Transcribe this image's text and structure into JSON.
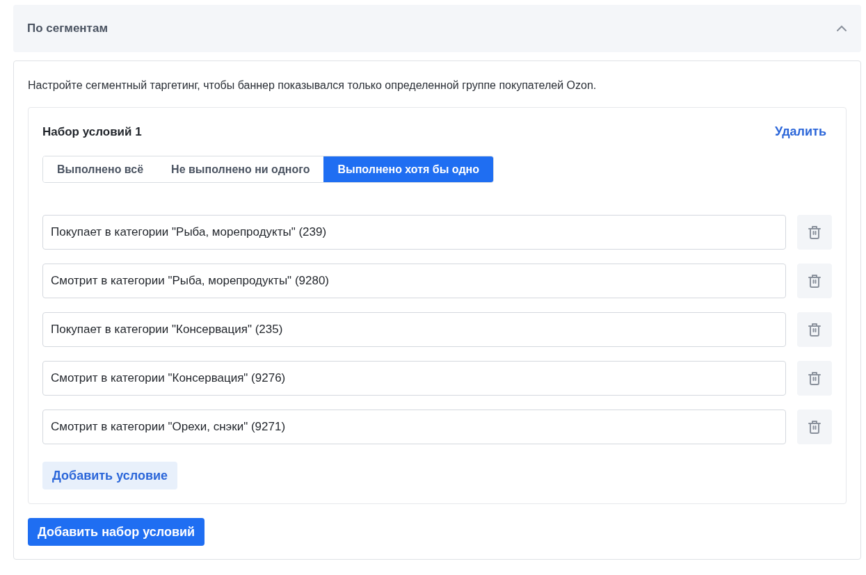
{
  "section": {
    "title": "По сегментам",
    "expanded": true
  },
  "description": "Настройте сегментный таргетинг, чтобы баннер показывался только определенной группе покупателей Ozon.",
  "condition_sets": [
    {
      "title": "Набор условий 1",
      "delete_label": "Удалить",
      "modes": [
        {
          "label": "Выполнено всё",
          "selected": false
        },
        {
          "label": "Не выполнено ни одного",
          "selected": false
        },
        {
          "label": "Выполнено хотя бы одно",
          "selected": true
        }
      ],
      "conditions": [
        {
          "value": "Покупает в категории \"Рыба, морепродукты\" (239)"
        },
        {
          "value": "Смотрит в категории \"Рыба, морепродукты\" (9280)"
        },
        {
          "value": "Покупает в категории \"Консервация\" (235)"
        },
        {
          "value": "Смотрит в категории \"Консервация\" (9276)"
        },
        {
          "value": "Смотрит в категории \"Орехи, снэки\" (9271)"
        }
      ],
      "add_condition_label": "Добавить условие"
    }
  ],
  "add_set_label": "Добавить набор условий"
}
